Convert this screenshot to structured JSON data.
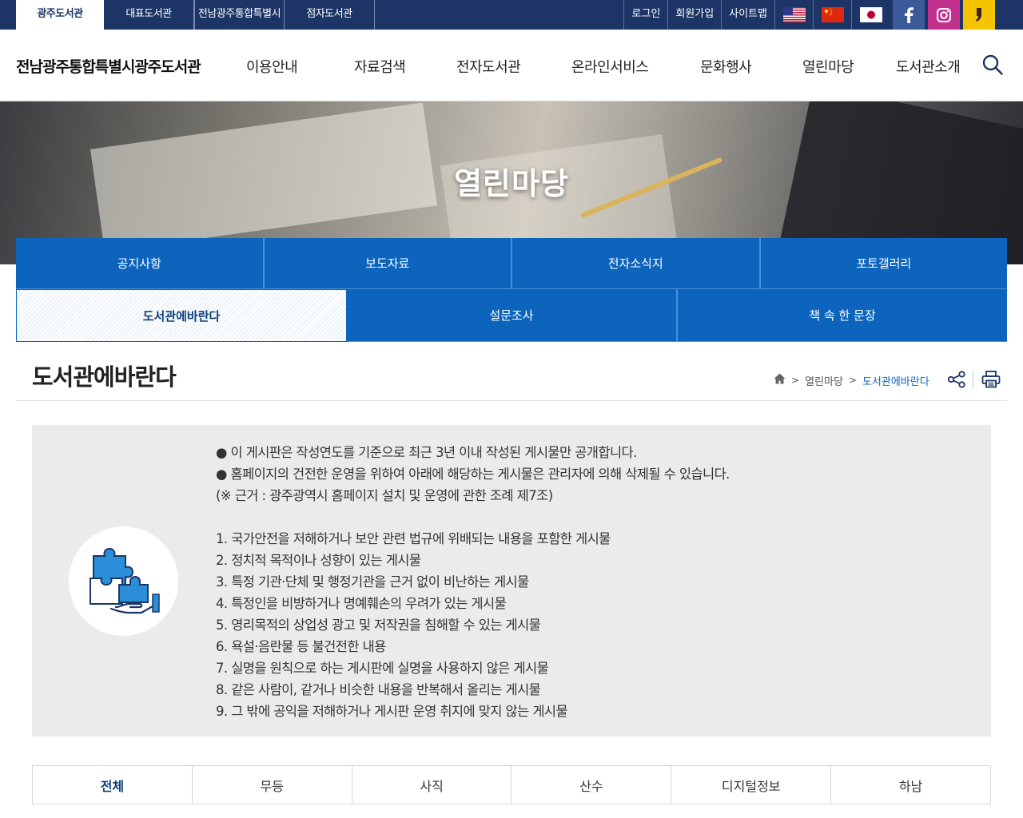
{
  "topbar": {
    "site_tabs": [
      {
        "label": "광주도서관",
        "active": true
      },
      {
        "label": "대표도서관",
        "active": false
      },
      {
        "label": "전남광주통합특별시",
        "active": false
      },
      {
        "label": "점자도서관",
        "active": false
      }
    ],
    "util_links": [
      "로그인",
      "회원가입",
      "사이트맵"
    ],
    "flags": [
      "us-flag-icon",
      "china-flag-icon",
      "japan-flag-icon"
    ],
    "social": [
      {
        "icon": "facebook-icon",
        "color": "#3b5a9a"
      },
      {
        "icon": "instagram-icon",
        "color": "#c2318d"
      },
      {
        "icon": "kakaostory-icon",
        "color": "#f5c400"
      }
    ],
    "background": "#1d3566"
  },
  "header": {
    "logo": "전남광주통합특별시광주도서관",
    "gnb": [
      "이용안내",
      "자료검색",
      "전자도서관",
      "온라인서비스",
      "문화행사",
      "열린마당",
      "도서관소개"
    ],
    "search_icon": "search-icon"
  },
  "visual": {
    "title": "열린마당"
  },
  "subnav": {
    "row1": [
      {
        "label": "공지사항",
        "active": false
      },
      {
        "label": "보도자료",
        "active": false
      },
      {
        "label": "전자소식지",
        "active": false
      },
      {
        "label": "포토갤러리",
        "active": false
      }
    ],
    "row2": [
      {
        "label": "도서관에바란다",
        "active": true
      },
      {
        "label": "설문조사",
        "active": false
      },
      {
        "label": "책 속 한 문장",
        "active": false
      }
    ],
    "accent": "#0d64bd"
  },
  "page": {
    "title": "도서관에바란다",
    "breadcrumb": {
      "home_icon": "home-icon",
      "items": [
        "열린마당",
        "도서관에바란다"
      ]
    },
    "tools": [
      "share-icon",
      "print-icon"
    ]
  },
  "notice": {
    "icon": "puzzle-icon",
    "intro": [
      "● 이 게시판은 작성연도를 기준으로 최근 3년 이내 작성된 게시물만 공개합니다.",
      "● 홈페이지의 건전한 운영을 위하여 아래에 해당하는 게시물은 관리자에 의해 삭제될 수 있습니다.",
      "(※ 근거 : 광주광역시 홈페이지 설치 및 운영에 관한 조례 제7조)"
    ],
    "rules": [
      "1. 국가안전을 저해하거나 보안 관련 법규에 위배되는 내용을 포함한 게시물",
      "2. 정치적 목적이나 성향이 있는 게시물",
      "3. 특정 기관·단체 및 행정기관을 근거 없이 비난하는 게시물",
      "4. 특정인을 비방하거나 명예훼손의 우려가 있는 게시물",
      "5. 영리목적의 상업성 광고 및 저작권을 침해할 수 있는 게시물",
      "6. 욕설·음란물 등 불건전한 내용",
      "7. 실명을 원칙으로 하는 게시판에 실명을 사용하지 않은 게시물",
      "8. 같은 사람이, 같거나 비슷한 내용을 반복해서 올리는 게시물",
      "9. 그 밖에 공익을 저해하거나 게시판 운영 취지에 맞지 않는 게시물"
    ]
  },
  "categories": [
    {
      "label": "전체",
      "active": true
    },
    {
      "label": "무등",
      "active": false
    },
    {
      "label": "사직",
      "active": false
    },
    {
      "label": "산수",
      "active": false
    },
    {
      "label": "디지털정보",
      "active": false
    },
    {
      "label": "하남",
      "active": false
    }
  ]
}
